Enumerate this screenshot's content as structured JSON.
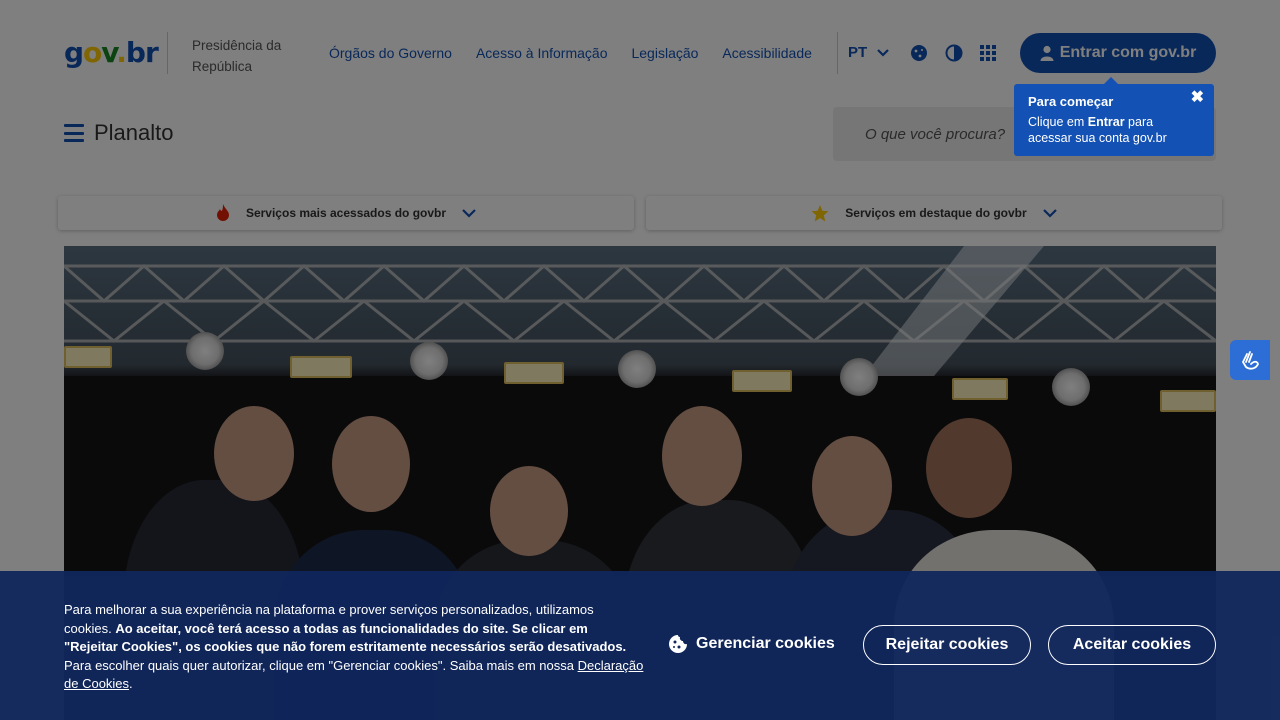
{
  "header": {
    "logo_parts": [
      "g",
      "o",
      "v",
      ".",
      "br"
    ],
    "org_name": "Presidência da República",
    "nav": [
      "Órgãos do Governo",
      "Acesso à Informação",
      "Legislação",
      "Acessibilidade"
    ],
    "language": "PT",
    "login_label": "Entrar com gov.br"
  },
  "tooltip": {
    "title": "Para começar",
    "text_before": "Clique em ",
    "text_bold": "Entrar",
    "text_after": " para acessar sua conta gov.br",
    "close": "✖"
  },
  "site": {
    "title": "Planalto",
    "search_placeholder": "O que você procura?"
  },
  "services": [
    {
      "label": "Serviços mais acessados do govbr",
      "icon": "flame-icon"
    },
    {
      "label": "Serviços em destaque do govbr",
      "icon": "star-icon"
    }
  ],
  "cookie": {
    "text_1": "Para melhorar a sua experiência na plataforma e prover serviços personalizados, utilizamos cookies. ",
    "text_bold": "Ao aceitar, você terá acesso a todas as funcionalidades do site. Se clicar em \"Rejeitar Cookies\", os cookies que não forem estritamente necessários serão desativados.",
    "text_2": " Para escolher quais quer autorizar, clique em \"Gerenciar cookies\". Saiba mais em nossa ",
    "link": "Declaração de Cookies",
    "text_end": ".",
    "manage_label": "Gerenciar cookies",
    "reject_label": "Rejeitar cookies",
    "accept_label": "Aceitar cookies"
  },
  "colors": {
    "primary": "#1351b4",
    "cookie_bg": "#10265c"
  }
}
